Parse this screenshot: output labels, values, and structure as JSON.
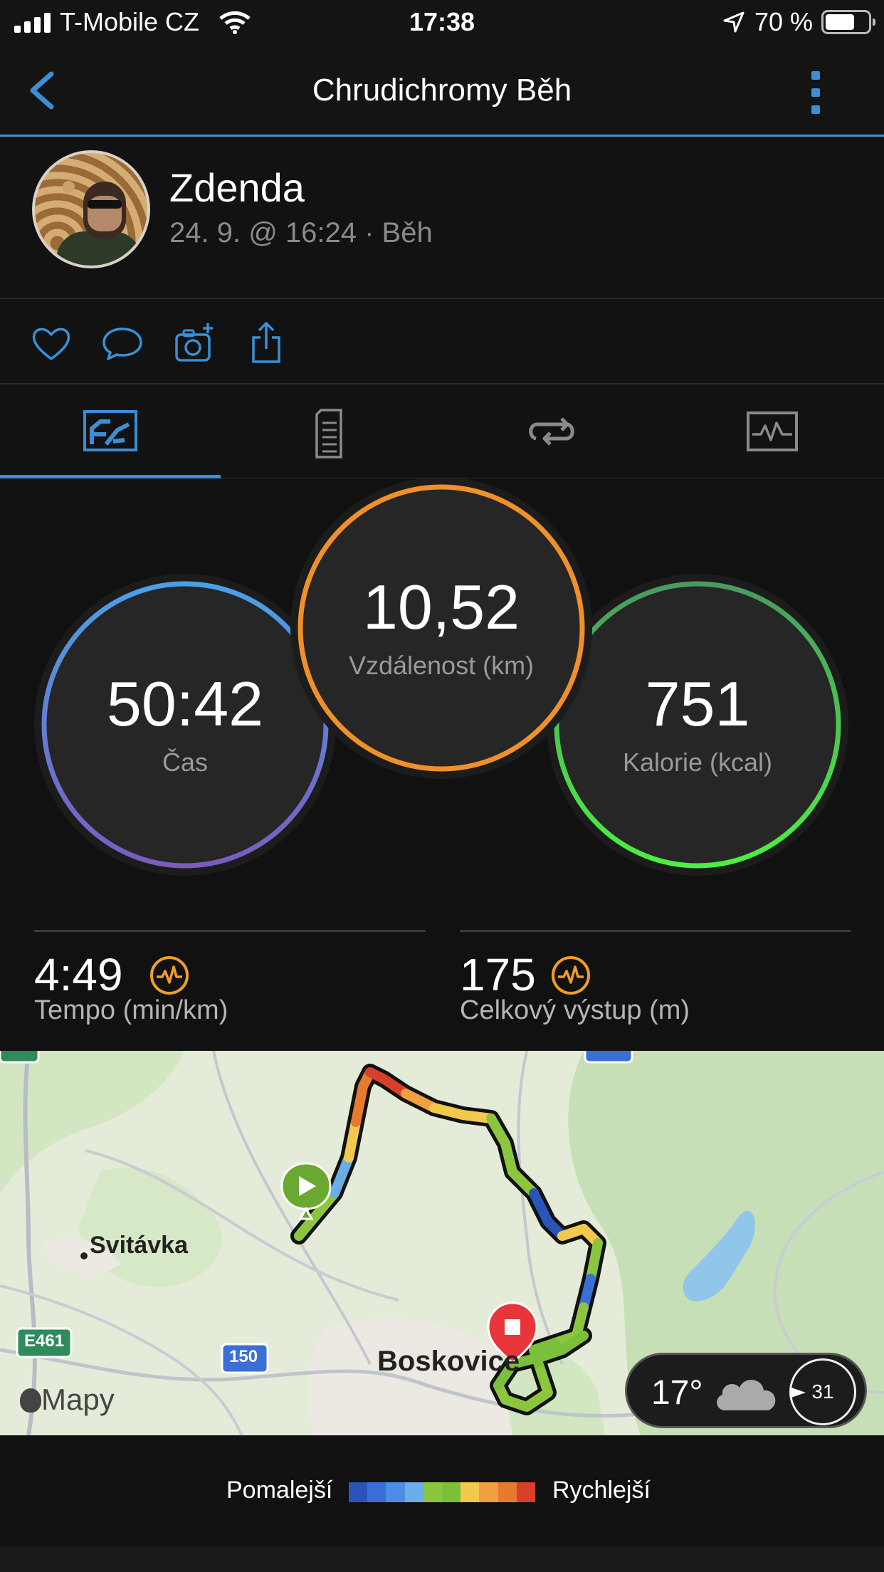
{
  "status_bar": {
    "carrier": "T-Mobile CZ",
    "time": "17:38",
    "battery_percent": "70 %"
  },
  "nav": {
    "title": "Chrudichromy Běh"
  },
  "profile": {
    "name": "Zdenda",
    "meta": "24. 9. @ 16:24 · Běh"
  },
  "stats": {
    "time": {
      "value": "50:42",
      "label": "Čas"
    },
    "distance": {
      "value": "10,52",
      "label": "Vzdálenost (km)"
    },
    "calories": {
      "value": "751",
      "label": "Kalorie (kcal)"
    },
    "pace": {
      "value": "4:49",
      "label": "Tempo (min/km)"
    },
    "ascent": {
      "value": "175",
      "label": "Celkový výstup (m)"
    }
  },
  "map": {
    "place_svitavka": "Svitávka",
    "place_boskovice": "Boskovice",
    "road_e461": "E461",
    "road_150": "150",
    "attribution": "Mapy",
    "weather_temp": "17°",
    "wind_speed": "31"
  },
  "legend": {
    "slower": "Pomalejší",
    "faster": "Rychlejší",
    "colors": [
      "#2a55b8",
      "#3a6fd6",
      "#4d8de6",
      "#6aaee8",
      "#8cc63f",
      "#7bbf3a",
      "#f2c94c",
      "#f0a040",
      "#e87a30",
      "#d8402a"
    ]
  },
  "colors": {
    "accent": "#3a8fd6",
    "time_ring_top": "#4aa0e8",
    "time_ring_bottom": "#7a5cc0",
    "distance_ring": "#f0902a",
    "calories_ring": "#4ce04a"
  }
}
